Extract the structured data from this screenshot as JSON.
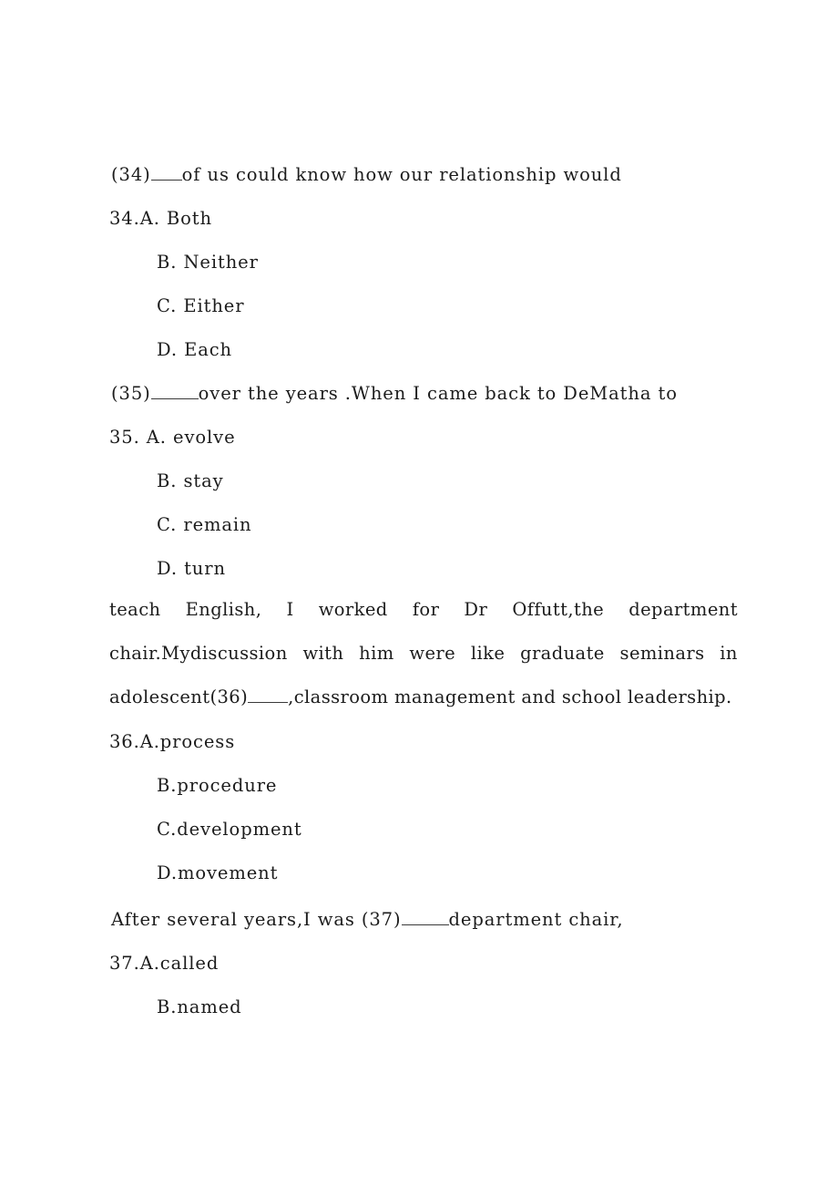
{
  "document": {
    "type": "english-cloze-exam-page",
    "background_color": "#ffffff",
    "text_color": "#1c1c1c"
  },
  "questions": [
    {
      "number": "34",
      "stem_prefix": "(34)",
      "stem_suffix": "of us could know how our relationship would",
      "options": [
        {
          "letter": "34.A.",
          "text": "Both"
        },
        {
          "letter": "B.",
          "text": "Neither"
        },
        {
          "letter": "C.",
          "text": "Either"
        },
        {
          "letter": "D.",
          "text": "Each"
        }
      ]
    },
    {
      "number": "35",
      "stem_prefix": "(35)",
      "stem_suffix": "over the years .When I came back to DeMatha to",
      "options": [
        {
          "letter": "35. A.",
          "text": "evolve"
        },
        {
          "letter": "B.",
          "text": "stay"
        },
        {
          "letter": "C.",
          "text": "remain"
        },
        {
          "letter": "D.",
          "text": "turn"
        }
      ]
    },
    {
      "number": "36",
      "options": [
        {
          "letter": "36.A.",
          "text": "process"
        },
        {
          "letter": "B.",
          "text": "procedure"
        },
        {
          "letter": "C.",
          "text": "development"
        },
        {
          "letter": "D.",
          "text": "movement"
        }
      ]
    },
    {
      "number": "37",
      "stem_before": "After several years,I was (37)",
      "stem_after": "department chair,",
      "options": [
        {
          "letter": "37.A.",
          "text": "called"
        },
        {
          "letter": "B.",
          "text": "named"
        }
      ]
    }
  ],
  "paragraph": {
    "line1_tokens": [
      "teach",
      "English,",
      "I",
      "worked",
      "for",
      "Dr",
      "Offutt,the",
      "department"
    ],
    "line2_tokens": [
      "chair.Mydiscussion",
      "with",
      "him",
      "were",
      "like",
      "graduate",
      "seminars",
      "in"
    ],
    "line3_before": "adolescent(36)",
    "line3_after": ",classroom management and school leadership."
  }
}
